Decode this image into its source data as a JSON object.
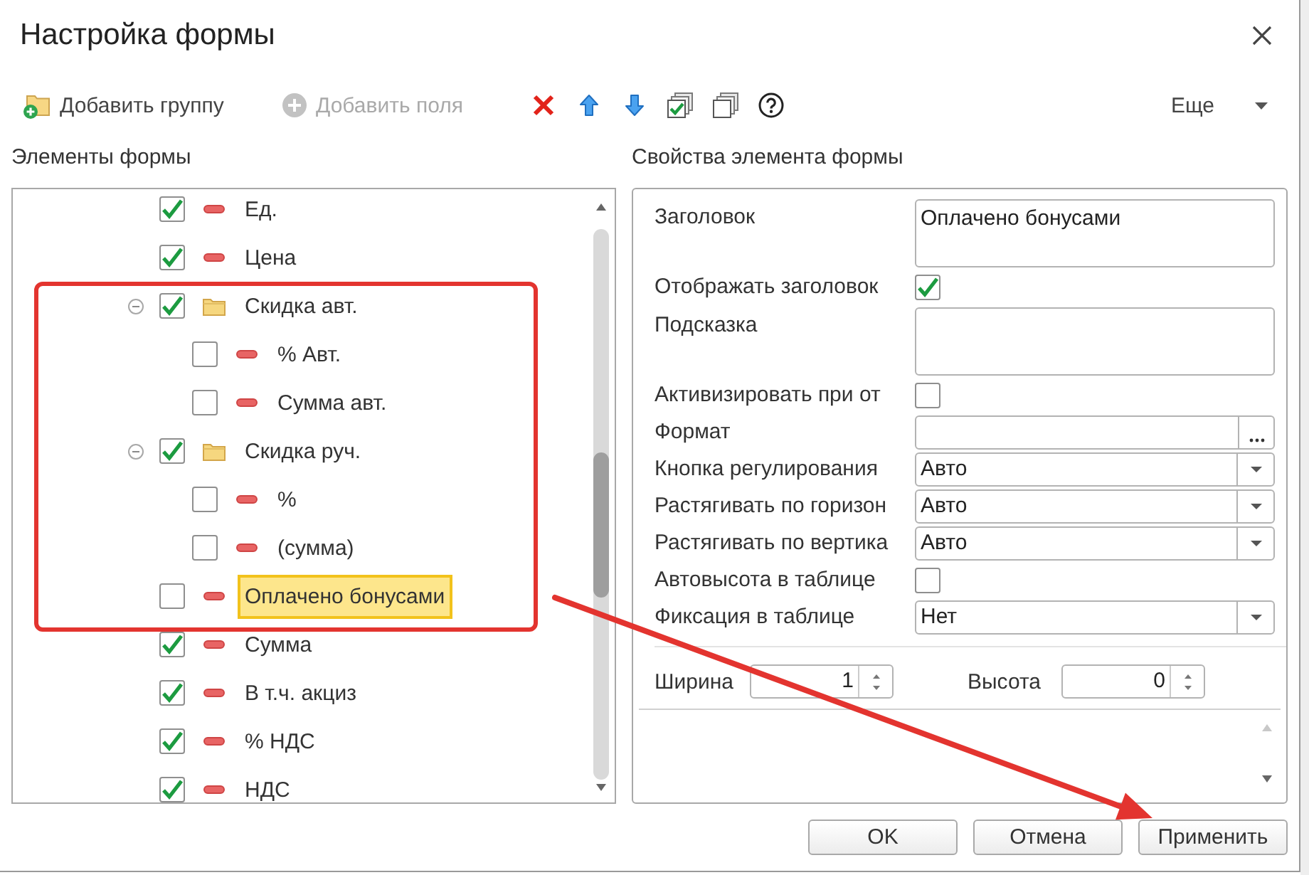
{
  "window": {
    "title": "Настройка формы"
  },
  "toolbar": {
    "add_group": {
      "label": "Добавить группу",
      "disabled": false
    },
    "add_fields": {
      "label": "Добавить поля",
      "disabled": true
    },
    "more": {
      "label": "Еще"
    }
  },
  "left_panel": {
    "title": "Элементы формы",
    "tree": [
      {
        "label": "Ед.",
        "kind": "field",
        "checked": true,
        "selected": false
      },
      {
        "label": "Цена",
        "kind": "field",
        "checked": true,
        "selected": false
      },
      {
        "label": "Скидка авт.",
        "kind": "group",
        "checked": true,
        "selected": false,
        "expanded": true,
        "children": [
          {
            "label": "% Авт.",
            "kind": "field",
            "checked": false,
            "selected": false
          },
          {
            "label": "Сумма авт.",
            "kind": "field",
            "checked": false,
            "selected": false
          }
        ]
      },
      {
        "label": "Скидка руч.",
        "kind": "group",
        "checked": true,
        "selected": false,
        "expanded": true,
        "children": [
          {
            "label": "%",
            "kind": "field",
            "checked": false,
            "selected": false
          },
          {
            "label": "(сумма)",
            "kind": "field",
            "checked": false,
            "selected": false
          }
        ]
      },
      {
        "label": "Оплачено бонусами",
        "kind": "field",
        "checked": false,
        "selected": true
      },
      {
        "label": "Сумма",
        "kind": "field",
        "checked": true,
        "selected": false
      },
      {
        "label": "В т.ч. акциз",
        "kind": "field",
        "checked": true,
        "selected": false
      },
      {
        "label": "% НДС",
        "kind": "field",
        "checked": true,
        "selected": false
      },
      {
        "label": "НДС",
        "kind": "field",
        "checked": true,
        "selected": false
      }
    ]
  },
  "right_panel": {
    "title": "Свойства элемента формы",
    "properties": [
      {
        "kind": "textarea",
        "label": "Заголовок",
        "value": "Оплачено бонусами"
      },
      {
        "kind": "checkbox",
        "label": "Отображать заголовок",
        "checked": true
      },
      {
        "kind": "textarea",
        "label": "Подсказка"
      },
      {
        "kind": "checkbox",
        "label": "Активизировать при от",
        "checked": false
      },
      {
        "kind": "picker",
        "label": "Формат"
      },
      {
        "kind": "select",
        "label": "Кнопка регулирования",
        "value": "Авто"
      },
      {
        "kind": "select",
        "label": "Растягивать по горизон",
        "value": "Авто"
      },
      {
        "kind": "select",
        "label": "Растягивать по вертика",
        "value": "Авто"
      },
      {
        "kind": "checkbox",
        "label": "Автовысота в таблице",
        "checked": false
      },
      {
        "kind": "select",
        "label": "Фиксация в таблице",
        "value": "Нет"
      }
    ],
    "size": [
      {
        "label": "Ширина",
        "value": "1"
      },
      {
        "label": "Высота",
        "value": "0"
      }
    ]
  },
  "buttons": [
    "OK",
    "Отмена",
    "Применить"
  ]
}
